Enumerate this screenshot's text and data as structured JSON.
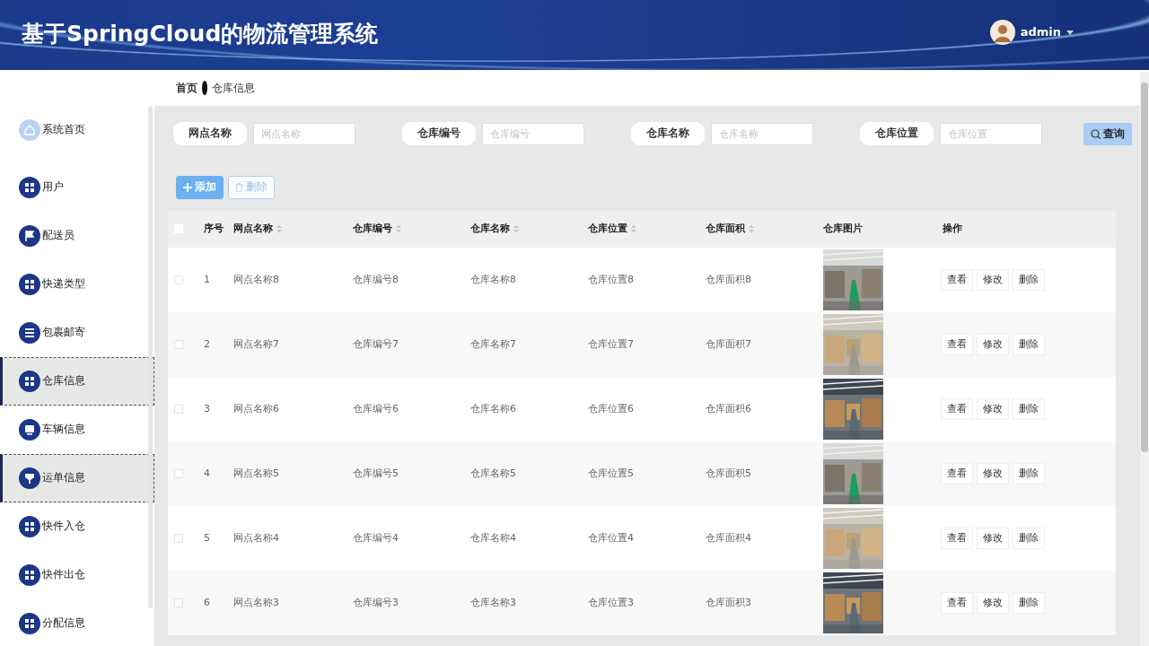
{
  "header": {
    "title": "基于SpringCloud的物流管理系统",
    "user": "admin"
  },
  "breadcrumb": [
    "首页",
    "仓库信息"
  ],
  "sidebar": {
    "items": [
      {
        "label": "系统首页",
        "kind": "home",
        "highlighted": false
      },
      {
        "label": "用户",
        "kind": "grid",
        "highlighted": false
      },
      {
        "label": "配送员",
        "kind": "flag",
        "highlighted": false
      },
      {
        "label": "快递类型",
        "kind": "grid",
        "highlighted": false
      },
      {
        "label": "包裹邮寄",
        "kind": "list",
        "highlighted": false
      },
      {
        "label": "仓库信息",
        "kind": "grid",
        "highlighted": true
      },
      {
        "label": "车辆信息",
        "kind": "monitor",
        "highlighted": false
      },
      {
        "label": "运单信息",
        "kind": "funnel",
        "highlighted": true
      },
      {
        "label": "快件入仓",
        "kind": "grid",
        "highlighted": false
      },
      {
        "label": "快件出仓",
        "kind": "grid",
        "highlighted": false
      },
      {
        "label": "分配信息",
        "kind": "grid",
        "highlighted": false
      }
    ]
  },
  "search": {
    "fields": [
      {
        "label": "网点名称",
        "placeholder": "网点名称"
      },
      {
        "label": "仓库编号",
        "placeholder": "仓库编号"
      },
      {
        "label": "仓库名称",
        "placeholder": "仓库名称"
      },
      {
        "label": "仓库位置",
        "placeholder": "仓库位置"
      }
    ],
    "button": "查询"
  },
  "actions": [
    {
      "label": "添加",
      "kind": "add",
      "disabled": false
    },
    {
      "label": "删除",
      "kind": "delete",
      "disabled": true
    }
  ],
  "table": {
    "all_checked": false,
    "columns": [
      {
        "label": "序号",
        "sortable": false
      },
      {
        "label": "网点名称",
        "sortable": true
      },
      {
        "label": "仓库编号",
        "sortable": true
      },
      {
        "label": "仓库名称",
        "sortable": true
      },
      {
        "label": "仓库位置",
        "sortable": true
      },
      {
        "label": "仓库面积",
        "sortable": true
      },
      {
        "label": "仓库图片",
        "sortable": false
      },
      {
        "label": "操作",
        "sortable": false
      }
    ],
    "rows": [
      {
        "checked": false,
        "cells": [
          "1",
          "网点名称8",
          "仓库编号8",
          "仓库名称8",
          "仓库位置8",
          "仓库面积8"
        ],
        "photo": {
          "kind": "picture"
        },
        "buttons": [
          "查看",
          "修改",
          "删除"
        ]
      },
      {
        "checked": false,
        "cells": [
          "2",
          "网点名称7",
          "仓库编号7",
          "仓库名称7",
          "仓库位置7",
          "仓库面积7"
        ],
        "photo": {
          "kind": "picture"
        },
        "buttons": [
          "查看",
          "修改",
          "删除"
        ]
      },
      {
        "checked": false,
        "cells": [
          "3",
          "网点名称6",
          "仓库编号6",
          "仓库名称6",
          "仓库位置6",
          "仓库面积6"
        ],
        "photo": {
          "kind": "picture"
        },
        "buttons": [
          "查看",
          "修改",
          "删除"
        ]
      },
      {
        "checked": false,
        "cells": [
          "4",
          "网点名称5",
          "仓库编号5",
          "仓库名称5",
          "仓库位置5",
          "仓库面积5"
        ],
        "photo": {
          "kind": "picture"
        },
        "buttons": [
          "查看",
          "修改",
          "删除"
        ]
      },
      {
        "checked": false,
        "cells": [
          "5",
          "网点名称4",
          "仓库编号4",
          "仓库名称4",
          "仓库位置4",
          "仓库面积4"
        ],
        "photo": {
          "kind": "picture"
        },
        "buttons": [
          "查看",
          "修改",
          "删除"
        ]
      },
      {
        "checked": false,
        "cells": [
          "6",
          "网点名称3",
          "仓库编号3",
          "仓库名称3",
          "仓库位置3",
          "仓库面积3"
        ],
        "photo": {
          "kind": "picture"
        },
        "buttons": [
          "查看",
          "修改",
          "删除"
        ]
      }
    ]
  }
}
